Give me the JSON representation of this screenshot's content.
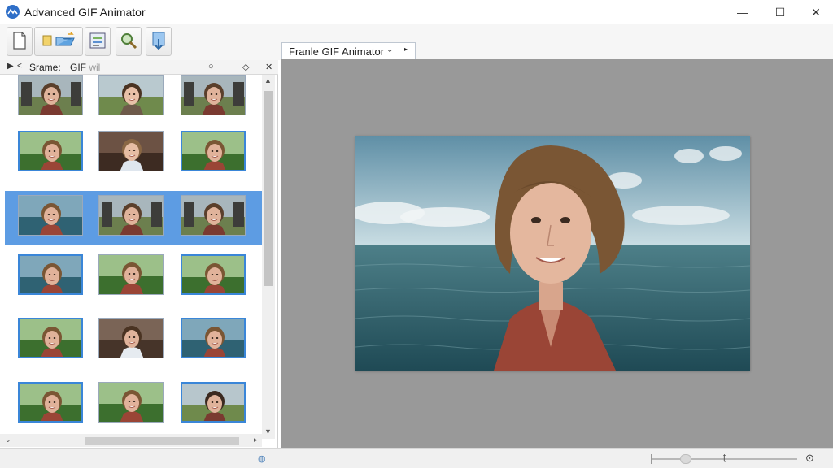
{
  "window": {
    "title": "Advanced GIF Animator",
    "minimize_glyph": "—",
    "maximize_glyph": "☐",
    "close_glyph": "✕"
  },
  "toolbar": {
    "buttons": [
      {
        "name": "new-file-button",
        "icon": "new-file-icon"
      },
      {
        "name": "open-file-button",
        "icon": "open-file-icon"
      },
      {
        "name": "properties-button",
        "icon": "properties-icon"
      },
      {
        "name": "zoom-button",
        "icon": "magnifier-icon"
      },
      {
        "name": "export-button",
        "icon": "export-icon"
      }
    ]
  },
  "frames_panel": {
    "header_label": "Srame:",
    "header_label2": "GIF",
    "header_label2_faint": "wil",
    "close_glyph": "✕",
    "rows": 6,
    "columns": 3,
    "selected_row": 3,
    "frame_subjects": [
      [
        "man-castle",
        "boy-landscape",
        "man-castle"
      ],
      [
        "woman-forest",
        "boy-room",
        "woman-forest"
      ],
      [
        "woman-sea",
        "man-castle",
        "man-castle"
      ],
      [
        "woman-sea",
        "woman-forest",
        "woman-forest"
      ],
      [
        "woman-forest",
        "man-room",
        "woman-sea"
      ],
      [
        "woman-forest",
        "woman-forest",
        "man-landscape"
      ]
    ]
  },
  "tab": {
    "label": "Franle GIF Animator",
    "caret": "⌄",
    "arrow": "▸"
  },
  "statusbar": {
    "zoom_label": "ʈ"
  },
  "colors": {
    "accent": "#5d9ce3",
    "canvas_bg": "#999999",
    "app_icon": "#2f6fc8"
  }
}
